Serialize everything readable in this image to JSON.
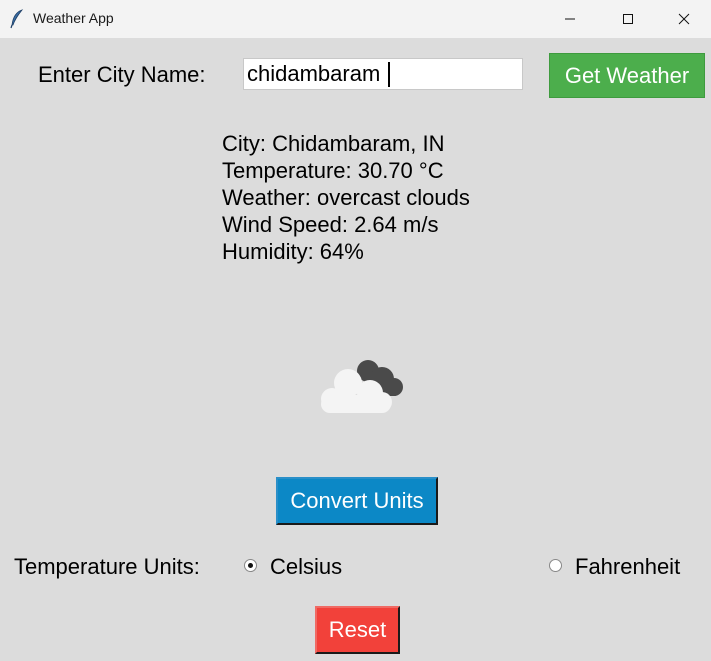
{
  "window": {
    "title": "Weather App",
    "icon": "feather-icon",
    "controls": [
      "minimize-icon",
      "maximize-icon",
      "close-icon"
    ]
  },
  "search": {
    "label": "Enter City Name:",
    "value": "chidambaram",
    "button_label": "Get Weather",
    "button_color": "#4cae4c"
  },
  "weather_info": {
    "city": "City: Chidambaram, IN",
    "temperature": "Temperature: 30.70 °C",
    "weather": "Weather: overcast clouds",
    "wind_speed": "Wind Speed: 2.64 m/s",
    "humidity": "Humidity: 64%"
  },
  "weather_icon": "overcast-clouds-icon",
  "convert": {
    "label": "Convert Units",
    "color": "#0c88c6"
  },
  "units": {
    "label": "Temperature Units:",
    "options": [
      {
        "label": "Celsius",
        "selected": true
      },
      {
        "label": "Fahrenheit",
        "selected": false
      }
    ]
  },
  "reset": {
    "label": "Reset",
    "color": "#f2413a"
  }
}
